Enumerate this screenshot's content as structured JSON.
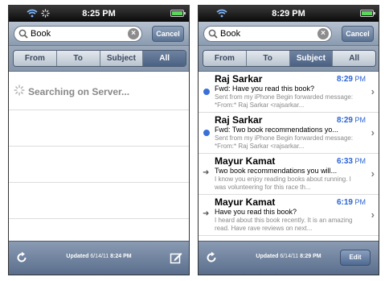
{
  "left": {
    "status_time": "8:25 PM",
    "search_query": "Book",
    "cancel_label": "Cancel",
    "segments": [
      "From",
      "To",
      "Subject",
      "All"
    ],
    "active_segment": "All",
    "searching_text": "Searching on Server...",
    "updated_label": "Updated",
    "updated_date": "6/14/11",
    "updated_time": "8:24 PM"
  },
  "right": {
    "status_time": "8:29 PM",
    "search_query": "Book",
    "cancel_label": "Cancel",
    "segments": [
      "From",
      "To",
      "Subject",
      "All"
    ],
    "active_segment": "Subject",
    "messages": [
      {
        "sender": "Raj Sarkar",
        "time": "8:29",
        "ampm": "PM",
        "subject": "Fwd: Have you read this book?",
        "preview": "Sent from my iPhone Begin forwarded message: *From:* Raj Sarkar <rajsarkar...",
        "indicator": "unread"
      },
      {
        "sender": "Raj Sarkar",
        "time": "8:29",
        "ampm": "PM",
        "subject": "Fwd: Two book recommendations yo...",
        "preview": "Sent from my iPhone Begin forwarded message: *From:* Raj Sarkar <rajsarkar...",
        "indicator": "unread"
      },
      {
        "sender": "Mayur Kamat",
        "time": "6:33",
        "ampm": "PM",
        "subject": "Two book recommendations you will...",
        "preview": "I know you enjoy reading books about running. I was volunteering for this race th...",
        "indicator": "forwarded"
      },
      {
        "sender": "Mayur Kamat",
        "time": "6:19",
        "ampm": "PM",
        "subject": "Have you read this book?",
        "preview": "I heard about this book recently. It is an amazing read. Have rave reviews on next...",
        "indicator": "forwarded"
      }
    ],
    "updated_label": "Updated",
    "updated_date": "6/14/11",
    "updated_time": "8:29 PM",
    "edit_label": "Edit"
  },
  "colors": {
    "accent": "#2a63d4",
    "unread_dot": "#3b6fd8",
    "toolbar": "#6f82a0"
  }
}
